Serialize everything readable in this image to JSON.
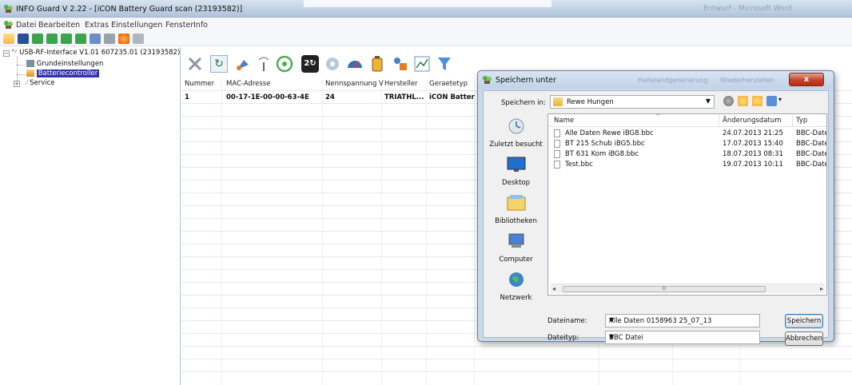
{
  "window": {
    "title": "INFO Guard V 2.22 - [iCON Battery Guard scan (23193582)]",
    "ghost_title": "Entwurf - Microsoft Word"
  },
  "menu": [
    "Datei",
    "Bearbeiten",
    "Extras",
    "Einstellungen",
    "Fenster",
    "Info"
  ],
  "toolbar1_icons": [
    "open-folder-icon",
    "save-icon",
    "device-icon",
    "download-icon",
    "upload-icon",
    "export-icon",
    "document-icon",
    "print-icon",
    "settings-icon",
    "edit-icon"
  ],
  "tree": {
    "root": "USB-RF-Interface V1.01 607235.01 (23193582)",
    "children": [
      "Grundeinstellungen",
      "Batteriecontroller",
      "Service"
    ],
    "selected": "Batteriecontroller"
  },
  "toolbar2_icons": [
    "disconnect-icon",
    "refresh-icon",
    "satellite-icon",
    "antenna-icon",
    "scan-icon",
    "counter-icon",
    "gear-wheel-icon",
    "gauge-icon",
    "battery-icon",
    "user-device-icon",
    "chart-icon",
    "filter-icon"
  ],
  "grid": {
    "headers": [
      "Nummer",
      "MAC-Adresse",
      "Nennspannung V",
      "Hersteller",
      "Geraetetyp"
    ],
    "rows": [
      [
        "1",
        "00-17-1E-00-00-63-4E",
        "24",
        "TRIATHL...",
        "iCON Batter"
      ]
    ]
  },
  "dialog": {
    "title": "Speichern unter",
    "ghost_titles": [
      "Haltelandgenerierung",
      "Wiederherstellen"
    ],
    "close_glyph": "x",
    "lookin_label": "Speichern in:",
    "lookin_value": "Rewe Hungen",
    "places": [
      "Zuletzt besucht",
      "Desktop",
      "Bibliotheken",
      "Computer",
      "Netzwerk"
    ],
    "list_headers": [
      "Name",
      "Änderungsdatum",
      "Typ"
    ],
    "files": [
      {
        "name": "Alle Daten Rewe iBG8.bbc",
        "date": "24.07.2013 21:25",
        "type": "BBC-Date"
      },
      {
        "name": "BT 215 Schub iBG5.bbc",
        "date": "17.07.2013 15:40",
        "type": "BBC-Date"
      },
      {
        "name": "BT 631 Kom iBG8.bbc",
        "date": "18.07.2013 08:31",
        "type": "BBC-Date"
      },
      {
        "name": "Test.bbc",
        "date": "19.07.2013 10:11",
        "type": "BBC-Date"
      }
    ],
    "filename_label": "Dateiname:",
    "filename_value": "Alle Daten 0158963 25_07_13",
    "filetype_label": "Dateityp:",
    "filetype_value": "BBC Datei",
    "save_label": "Speichern",
    "cancel_label": "Abbrechen"
  },
  "colors": {
    "selection": "#3333aa",
    "dialog_frame": "#c9d8ea",
    "close_button": "#c7422a"
  }
}
